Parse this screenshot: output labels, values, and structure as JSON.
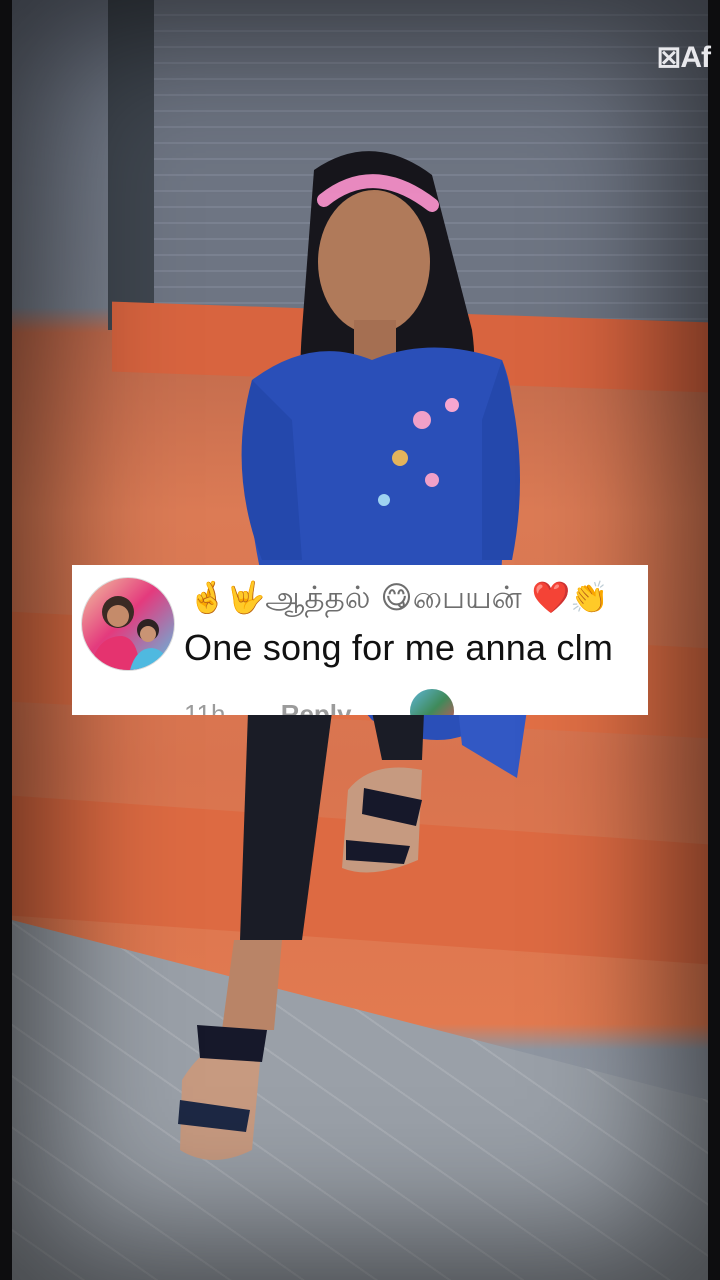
{
  "watermark": {
    "logo_text": "Af",
    "logo_icon": "capcut-icon"
  },
  "comment": {
    "username": "🤞🤟ஆத்தல் 😋பையன் ❤️👏",
    "text": "One song for me anna clm",
    "time": "11h",
    "reply_label": "Reply"
  }
}
